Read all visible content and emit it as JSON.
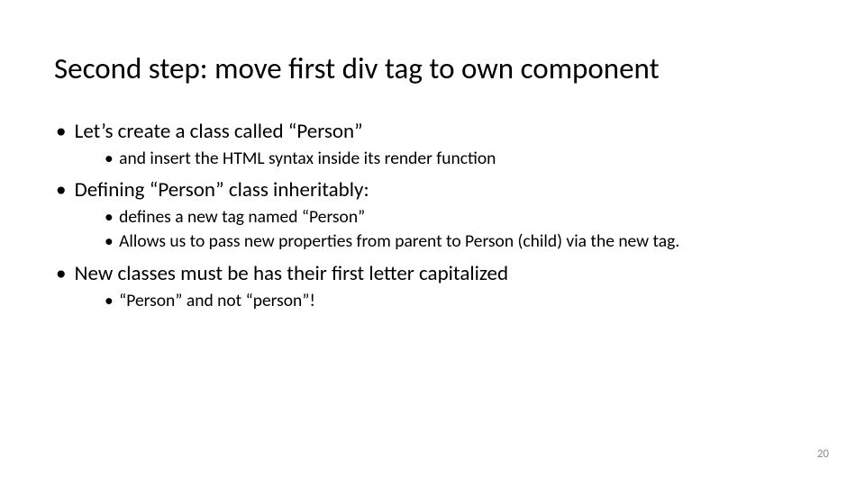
{
  "slide": {
    "title": "Second step: move first div tag to own component",
    "bullets": {
      "b1": "Let’s create a class called “Person”",
      "b1_1": "and insert the HTML syntax inside its render function",
      "b2": "Defining “Person” class inheritably:",
      "b2_1": " defines a new tag named “Person”",
      "b2_2": "Allows us to pass new properties from parent to Person (child) via the new tag.",
      "b3": "New classes must be has their first letter capitalized",
      "b3_1": "“Person” and not “person”!"
    },
    "page_number": "20"
  }
}
